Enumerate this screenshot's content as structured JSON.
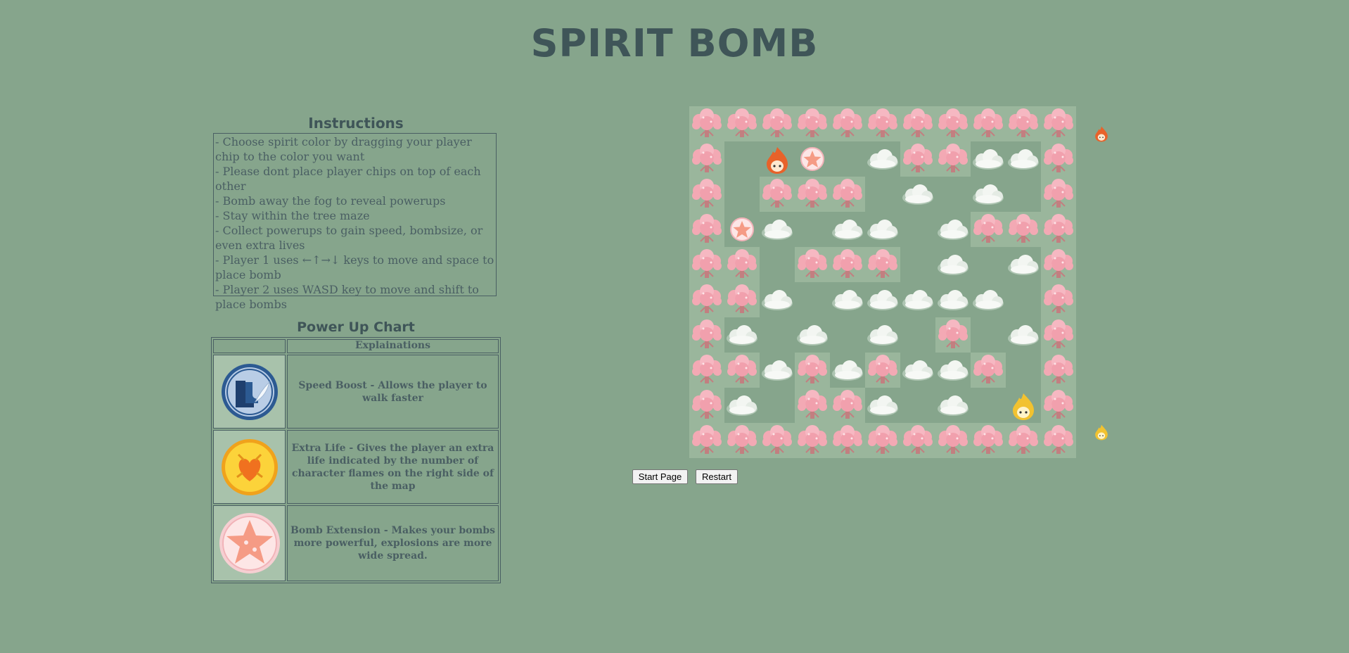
{
  "title": "SPIRIT BOMB",
  "instructions": {
    "title": "Instructions",
    "lines": [
      "- Choose spirit color by dragging your player chip to the color you want",
      "- Please dont place player chips on top of each other",
      "- Bomb away the fog to reveal powerups",
      "- Stay within the tree maze",
      "- Collect powerups to gain speed, bombsize, or even extra lives",
      "- Player 1 uses ←↑→↓ keys to move and space to place bomb",
      "- Player 2 uses WASD key to move and shift to place bombs"
    ]
  },
  "powerups": {
    "title": "Power Up Chart",
    "header": "Explainations",
    "rows": [
      {
        "icon": "speed-boost-icon",
        "text": "Speed Boost - Allows the player to walk faster"
      },
      {
        "icon": "extra-life-icon",
        "text": "Extra Life - Gives the player an extra life indicated by the number of character flames on the right side of the map"
      },
      {
        "icon": "bomb-extension-icon",
        "text": "Bomb Extension - Makes your bombs more powerful, explosions are more wide spread."
      }
    ]
  },
  "game": {
    "legend": {
      "T": "tree",
      "F": "fog",
      ".": "empty",
      "R": "player1-red-flame",
      "Y": "player2-yellow-flame",
      "S": "bomb-extension-powerup"
    },
    "map": [
      "TTTTTTTTTTT",
      "T.RS.FTTFFT",
      "T.TTT.F.F.T",
      "TSF.FF.FTTT",
      "TT.TTT.F.FT",
      "TTF.FFFFF.T",
      "TF.F.F.T.FT",
      "TTFTFTFFT.T",
      "TF.TTF.F.YT",
      "TTTTTTTTTTT"
    ],
    "player1_lives": 1,
    "player2_lives": 1,
    "colors": {
      "background": "#86a58c",
      "player1": "#e8622a",
      "player2": "#f2c230",
      "tree": "#f3a9b4"
    }
  },
  "buttons": {
    "start": "Start Page",
    "restart": "Restart"
  }
}
